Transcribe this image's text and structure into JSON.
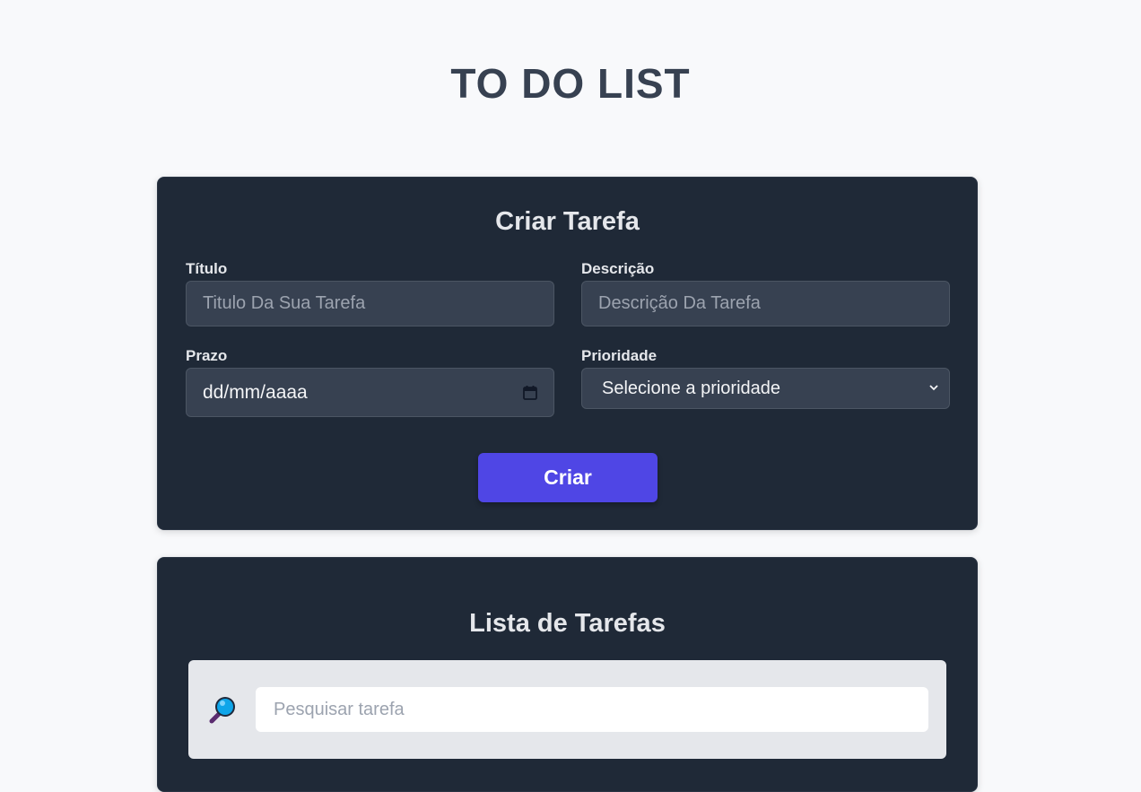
{
  "app": {
    "title": "TO DO LIST"
  },
  "create_form": {
    "heading": "Criar Tarefa",
    "title_label": "Título",
    "title_placeholder": "Titulo Da Sua Tarefa",
    "description_label": "Descrição",
    "description_placeholder": "Descrição Da Tarefa",
    "deadline_label": "Prazo",
    "deadline_placeholder": "dd/mm/aaaa",
    "priority_label": "Prioridade",
    "priority_selected": "Selecione a prioridade",
    "submit_label": "Criar"
  },
  "task_list": {
    "heading": "Lista de Tarefas",
    "search_placeholder": "Pesquisar tarefa"
  },
  "colors": {
    "background": "#f8f9fb",
    "card": "#1f2937",
    "field": "#374151",
    "accent": "#4f46e5",
    "title": "#374151"
  },
  "icons": {
    "date": "calendar-icon",
    "select": "chevron-down-icon",
    "search": "magnifying-glass-icon"
  }
}
